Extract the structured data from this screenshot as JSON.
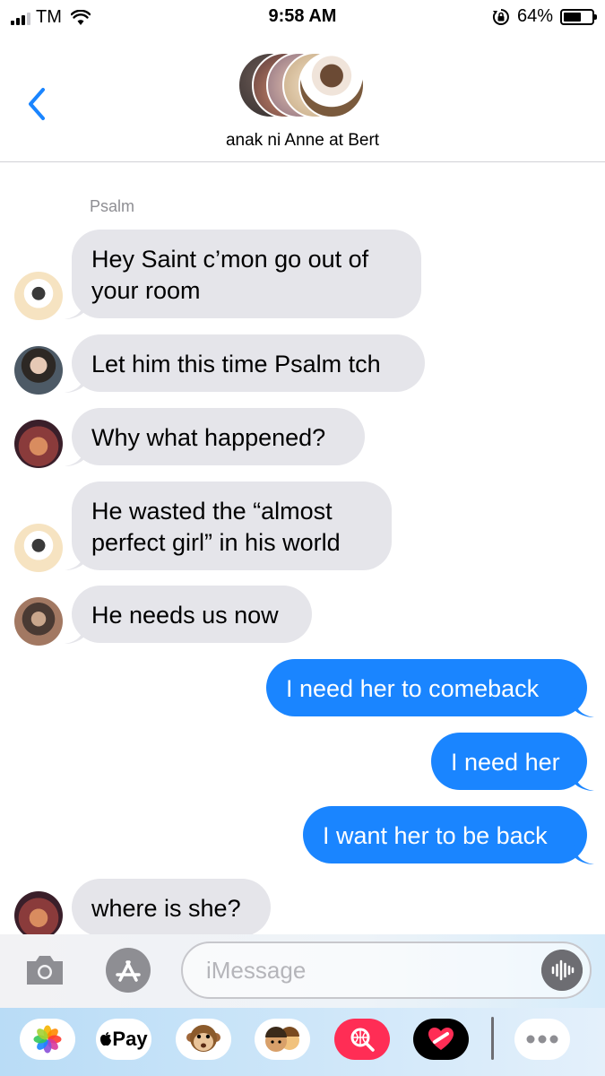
{
  "status_bar": {
    "carrier": "TM",
    "time": "9:58 AM",
    "battery": "64%",
    "battery_level": 0.64
  },
  "header": {
    "group_name": "anak ni Anne at Bert",
    "back_icon": "chevron-left-icon"
  },
  "conversation": {
    "sender_label": "Psalm",
    "messages": [
      {
        "direction": "incoming",
        "text": "Hey Saint c’mon go out of\nyour room"
      },
      {
        "direction": "incoming",
        "text": "Let him this time Psalm tch"
      },
      {
        "direction": "incoming",
        "text": "Why what happened?"
      },
      {
        "direction": "incoming",
        "text": "He wasted the “almost\nperfect girl” in his world"
      },
      {
        "direction": "incoming",
        "text": "He needs us now"
      },
      {
        "direction": "outgoing",
        "text": "I need her to comeback"
      },
      {
        "direction": "outgoing",
        "text": "I need her"
      },
      {
        "direction": "outgoing",
        "text": "I want her to be back"
      },
      {
        "direction": "incoming",
        "text": "where is she?"
      }
    ]
  },
  "input_bar": {
    "placeholder": "iMessage",
    "camera_icon": "camera-icon",
    "appstore_icon": "app-store-icon",
    "audio_icon": "audio-waveform-icon"
  },
  "app_drawer": {
    "apps": [
      {
        "name": "photos-icon"
      },
      {
        "name": "apple-pay-icon",
        "label": "Pay"
      },
      {
        "name": "animoji-monkey-icon"
      },
      {
        "name": "memoji-icon"
      },
      {
        "name": "web-images-search-icon"
      },
      {
        "name": "digital-touch-heart-icon"
      },
      {
        "name": "more-icon"
      }
    ]
  },
  "colors": {
    "outgoing_bubble": "#1a85ff",
    "incoming_bubble": "#e5e5ea",
    "accent": "#1a85ff"
  }
}
